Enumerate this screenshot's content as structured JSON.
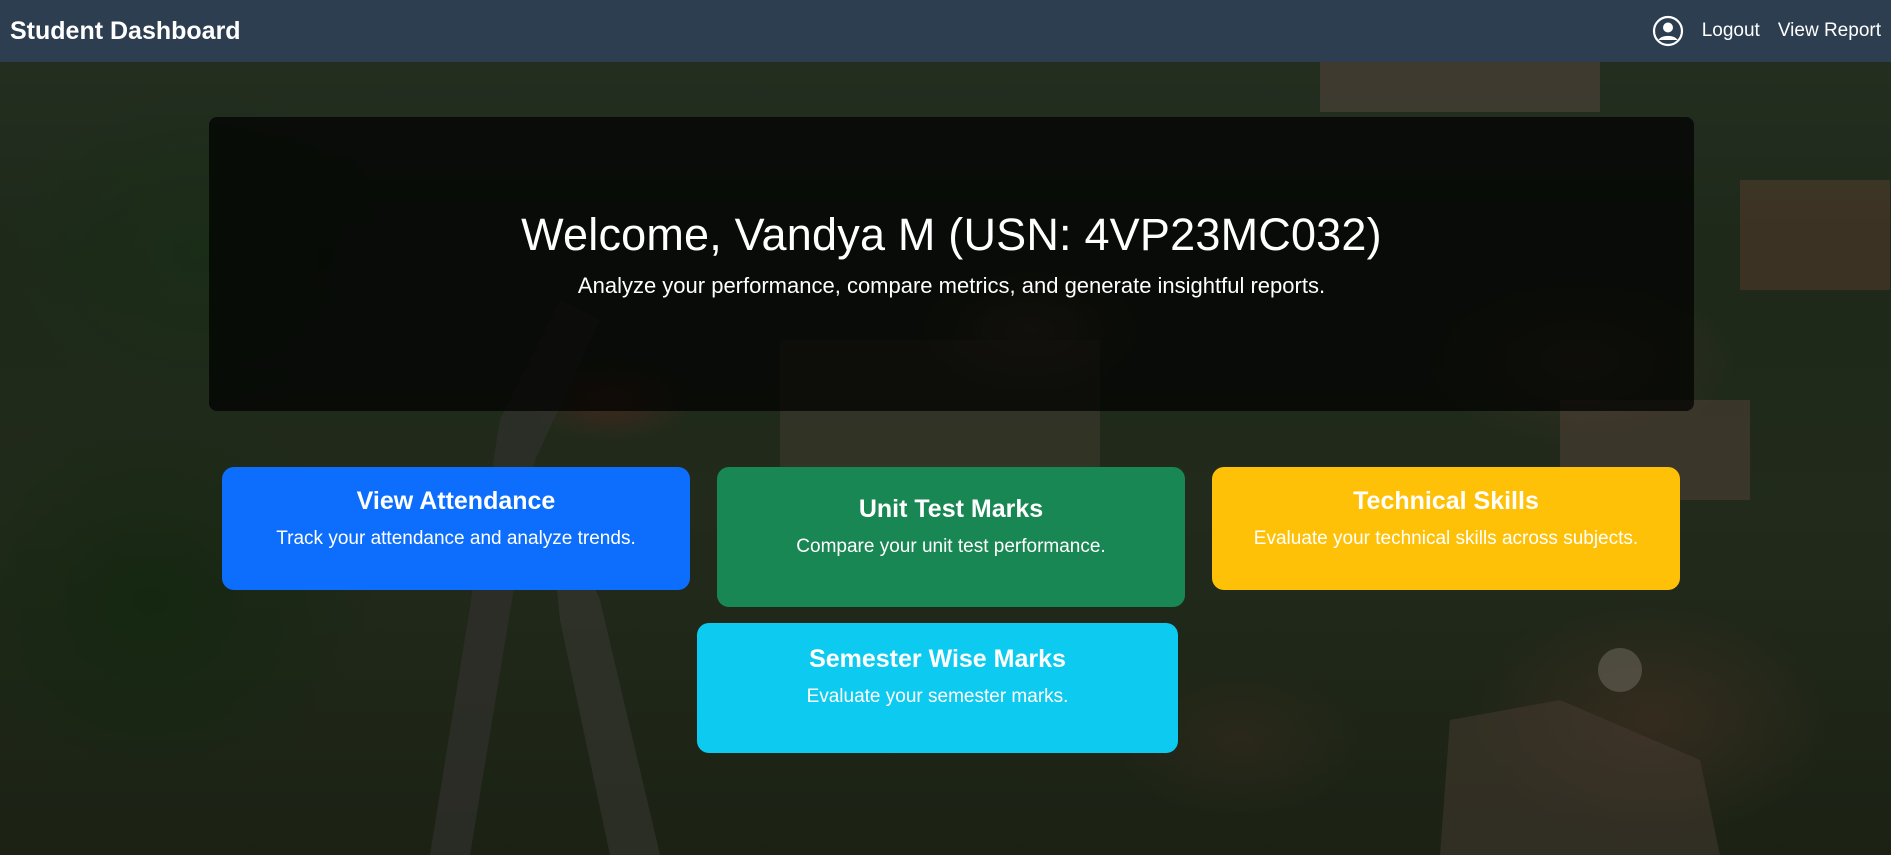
{
  "navbar": {
    "brand": "Student Dashboard",
    "user_icon": "user-circle-icon",
    "logout_label": "Logout",
    "view_report_label": "View Report",
    "bg_color": "#2c3e50"
  },
  "hero": {
    "title": "Welcome, Vandya M (USN: 4VP23MC032)",
    "subtitle": "Analyze your performance, compare metrics, and generate insightful reports."
  },
  "cards": [
    {
      "title": "View Attendance",
      "description": "Track your attendance and analyze trends.",
      "color": "#0d6efd"
    },
    {
      "title": "Unit Test Marks",
      "description": "Compare your unit test performance.",
      "color": "#198754"
    },
    {
      "title": "Technical Skills",
      "description": "Evaluate your technical skills across subjects.",
      "color": "#ffc107"
    },
    {
      "title": "Semester Wise Marks",
      "description": "Evaluate your semester marks.",
      "color": "#0dcaf0"
    }
  ]
}
